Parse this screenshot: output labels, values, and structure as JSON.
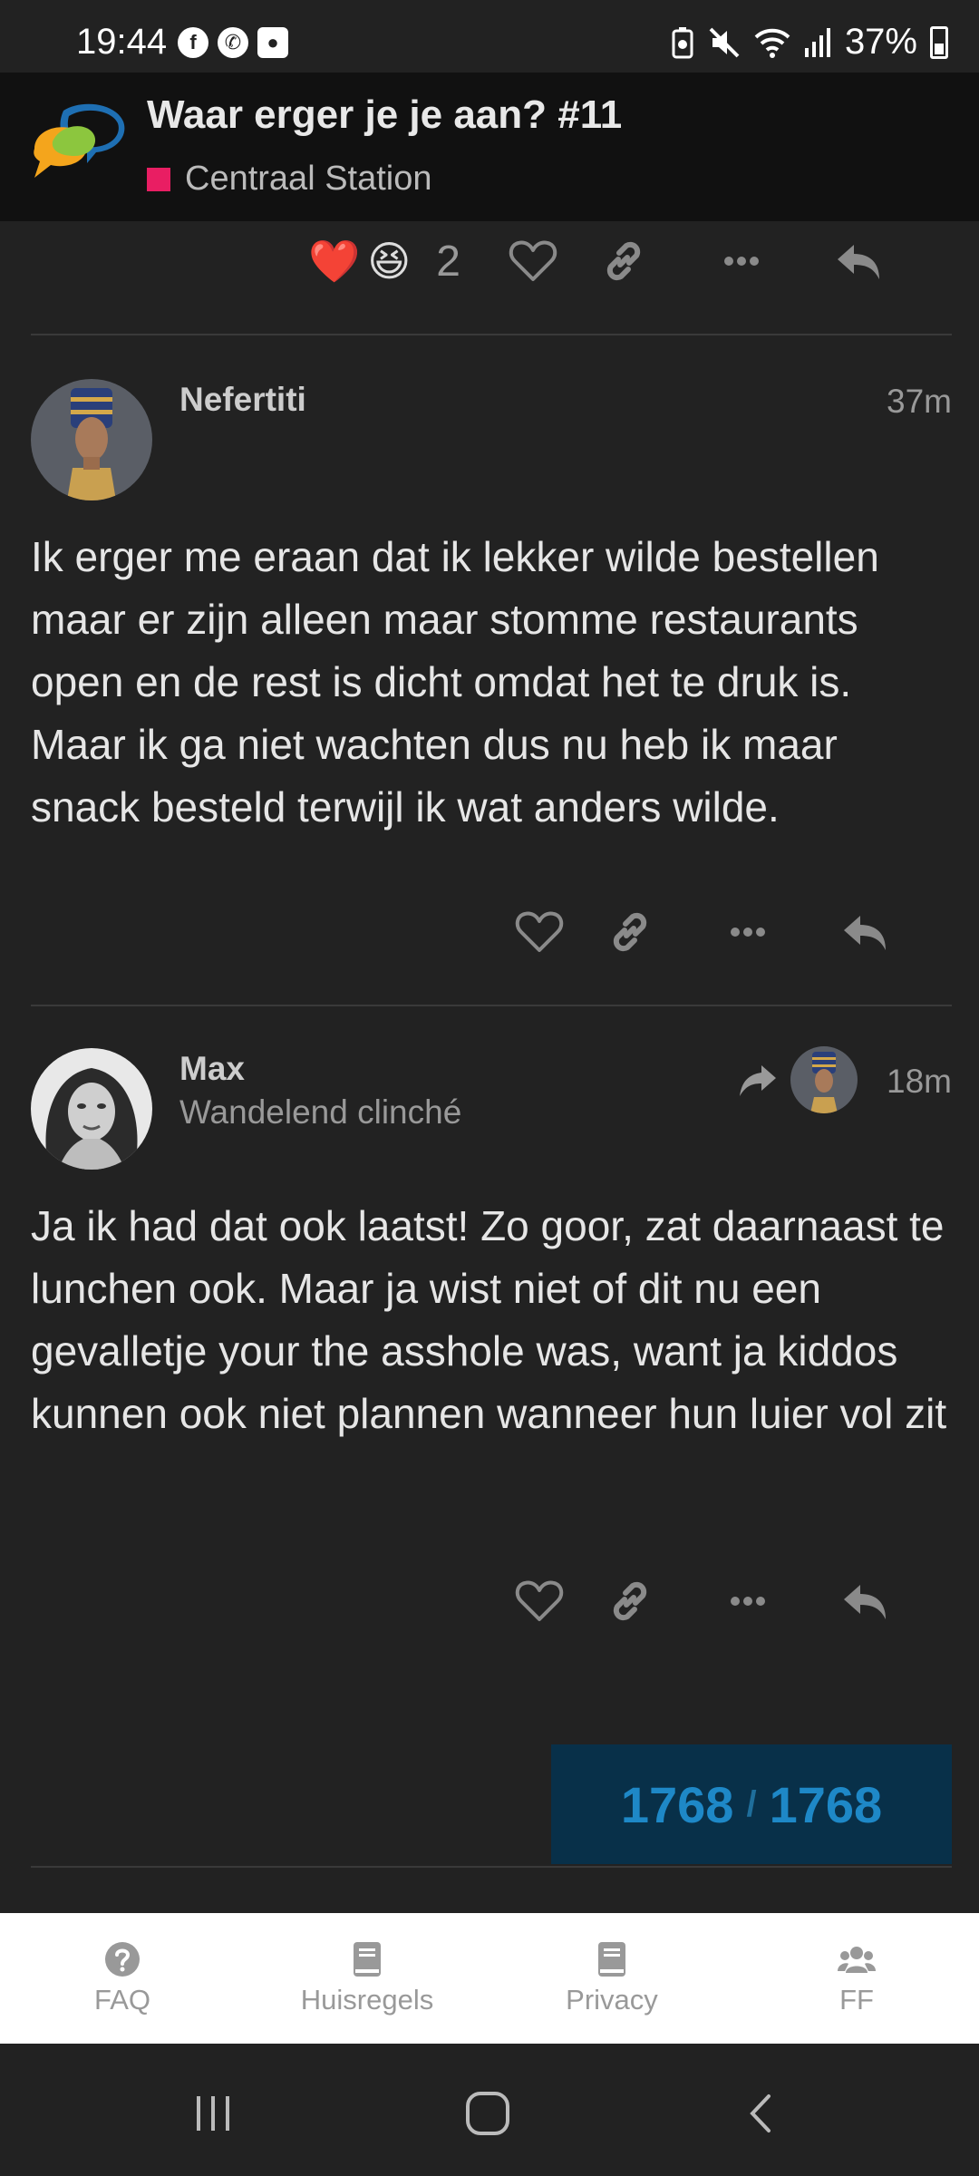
{
  "status_bar": {
    "time": "19:44",
    "battery": "37%",
    "app_icons": [
      "facebook-icon",
      "whatsapp-icon",
      "screen-recorder-icon"
    ]
  },
  "header": {
    "title": "Waar erger je je aan? #11",
    "category": "Centraal Station",
    "category_color": "#e91e63"
  },
  "previous_post": {
    "reactions": [
      "❤️",
      "😆"
    ],
    "reaction_count": "2"
  },
  "posts": [
    {
      "username": "Nefertiti",
      "user_title": "",
      "time": "37m",
      "body": "Ik erger me eraan dat ik lekker wilde bestellen maar er zijn alleen maar stomme restaurants open en de rest is dicht omdat het te druk is. Maar ik ga niet wachten dus nu heb ik maar snack besteld terwijl ik wat anders wilde."
    },
    {
      "username": "Max",
      "user_title": "Wandelend clinché",
      "time": "18m",
      "body": "Ja ik had dat ook laatst! Zo goor, zat daarnaast te lunchen ook. Maar ja wist niet of dit nu een gevalletje your the asshole was, want ja kiddos kunnen ook niet plannen wanneer hun luier vol zit"
    }
  ],
  "progress": {
    "current": "1768",
    "separator": "/",
    "total": "1768"
  },
  "footer": {
    "items": [
      {
        "label": "FAQ",
        "icon": "question-circle-icon"
      },
      {
        "label": "Huisregels",
        "icon": "book-icon"
      },
      {
        "label": "Privacy",
        "icon": "book-icon"
      },
      {
        "label": "FF",
        "icon": "users-icon"
      }
    ]
  },
  "colors": {
    "background": "#222222",
    "header_bg": "#111111",
    "progress_bg": "#083049",
    "progress_text": "#1e88c7",
    "footer_bg": "#ffffff"
  }
}
